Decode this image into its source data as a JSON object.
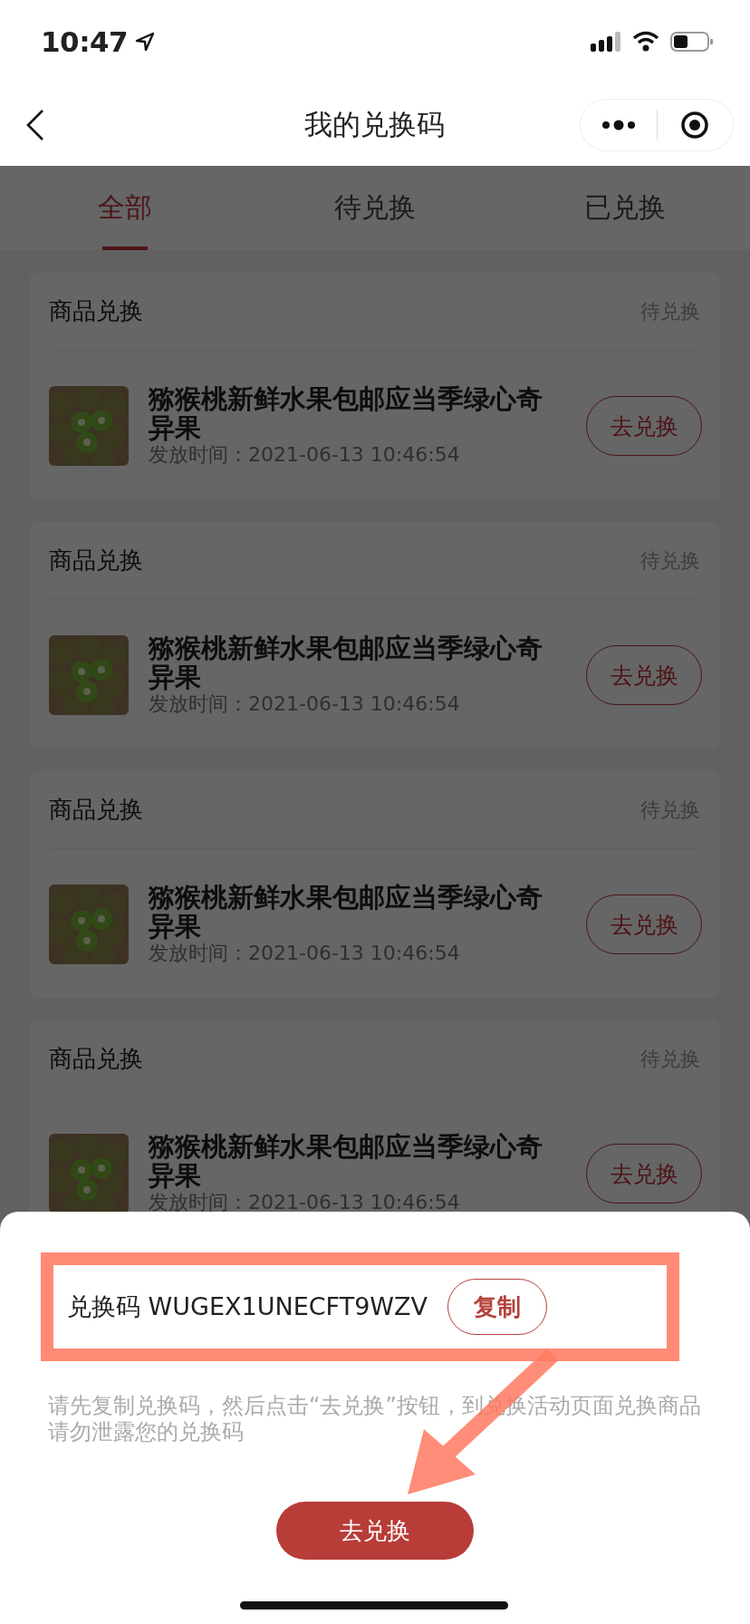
{
  "status_bar": {
    "time": "10:47"
  },
  "nav": {
    "title": "我的兑换码"
  },
  "tabs": [
    {
      "label": "全部",
      "selected": true
    },
    {
      "label": "待兑换",
      "selected": false
    },
    {
      "label": "已兑换",
      "selected": false
    }
  ],
  "cards": [
    {
      "type_label": "商品兑换",
      "status": "待兑换",
      "product": {
        "kind": "picture",
        "name": "猕猴桃新鲜水果包邮应当季绿心奇异果",
        "issued": "发放时间：2021-06-13 10:46:54"
      },
      "action": "去兑换"
    },
    {
      "type_label": "商品兑换",
      "status": "待兑换",
      "product": {
        "kind": "picture",
        "name": "猕猴桃新鲜水果包邮应当季绿心奇异果",
        "issued": "发放时间：2021-06-13 10:46:54"
      },
      "action": "去兑换"
    },
    {
      "type_label": "商品兑换",
      "status": "待兑换",
      "product": {
        "kind": "picture",
        "name": "猕猴桃新鲜水果包邮应当季绿心奇异果",
        "issued": "发放时间：2021-06-13 10:46:54"
      },
      "action": "去兑换"
    },
    {
      "type_label": "商品兑换",
      "status": "待兑换",
      "product": {
        "kind": "picture",
        "name": "猕猴桃新鲜水果包邮应当季绿心奇异果",
        "issued": "发放时间：2021-06-13 10:46:54"
      },
      "action": "去兑换"
    }
  ],
  "sheet": {
    "code_label": "兑换码",
    "code": "WUGEX1UNECFT9WZV",
    "copy": "复制",
    "hints": [
      "请先复制兑换码，然后点击“去兑换”按钮，到兑换活动页面兑换商品",
      "请勿泄露您的兑换码"
    ],
    "action": "去兑换"
  }
}
